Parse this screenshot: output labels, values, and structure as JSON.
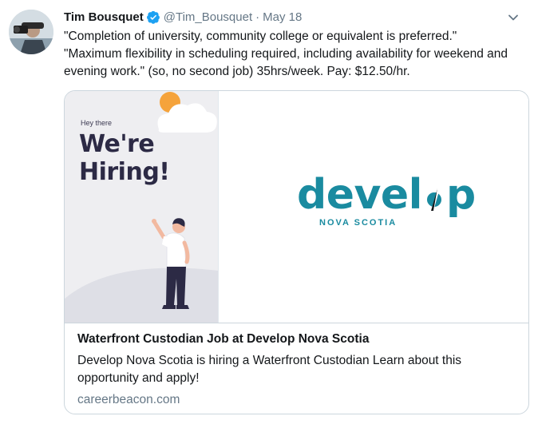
{
  "author": {
    "name": "Tim Bousquet",
    "handle": "@Tim_Bousquet",
    "separator": "·",
    "date": "May 18"
  },
  "tweet": {
    "line1": "\"Completion of university, community college or equivalent is preferred.\"",
    "line2": "\"Maximum flexibility in scheduling required, including availability for weekend and evening work.\" (so, no second job) 35hrs/week. Pay: $12.50/hr."
  },
  "card": {
    "image_left": {
      "small_text": "Hey there",
      "headline_1": "We're",
      "headline_2": "Hiring!"
    },
    "logo": {
      "word": "develop",
      "word_start": "devel",
      "word_end": "p",
      "subtitle": "NOVA SCOTIA"
    },
    "title": "Waterfront Custodian Job at Develop Nova Scotia",
    "description": "Develop Nova Scotia is hiring a Waterfront Custodian Learn about this opportunity and apply!",
    "domain": "careerbeacon.com"
  },
  "colors": {
    "verified": "#1da1f2",
    "logo_teal": "#1a8ba0",
    "muted": "#657786",
    "text": "#14171a"
  },
  "icons": {
    "verified": "verified-badge-icon",
    "caret": "chevron-down-icon"
  }
}
